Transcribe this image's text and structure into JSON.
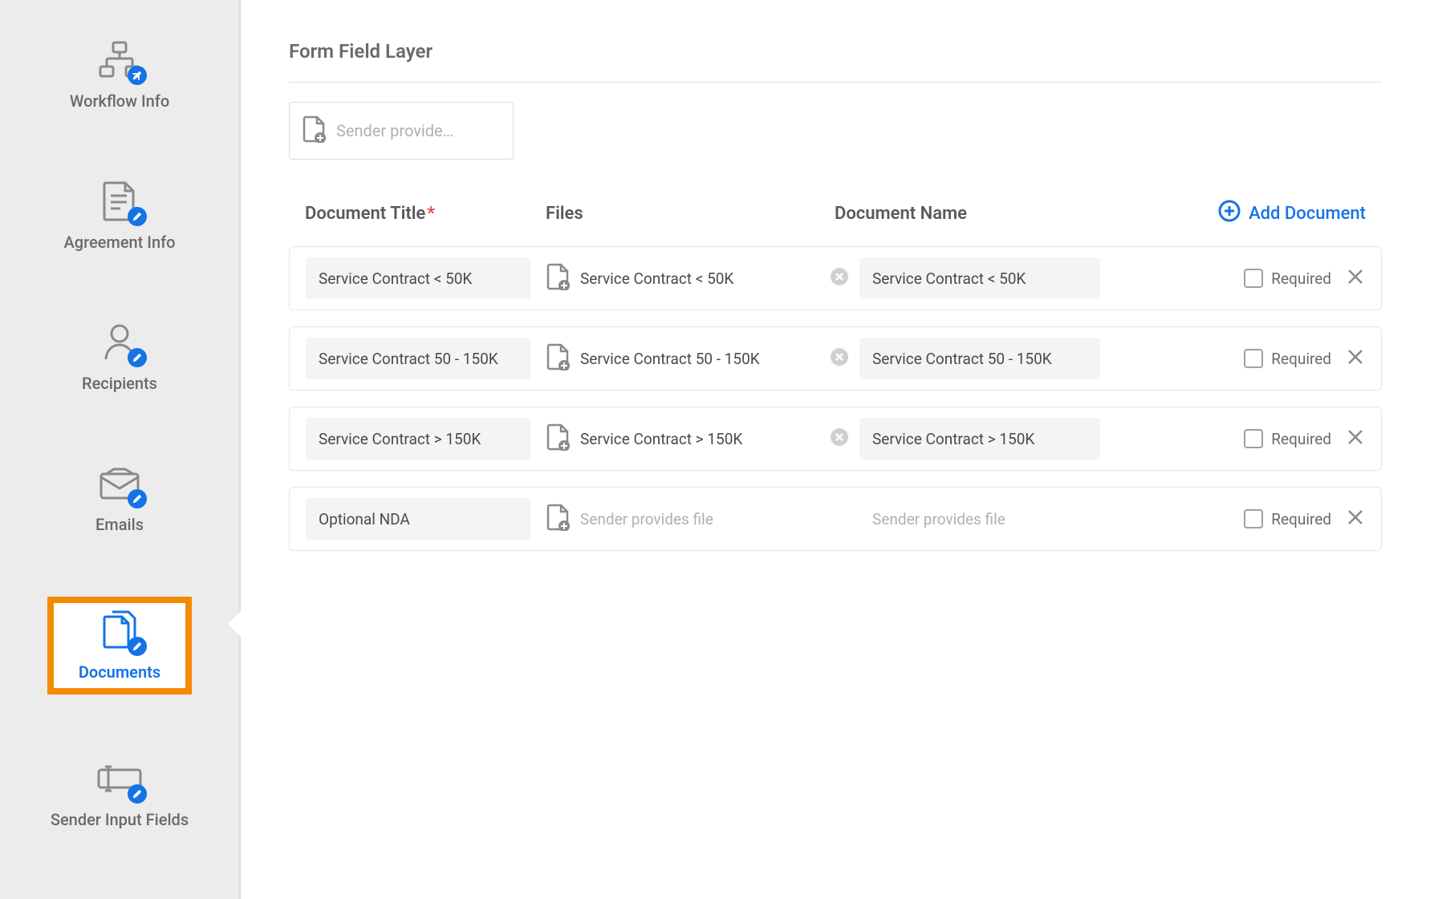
{
  "sidebar": {
    "items": [
      {
        "label": "Workflow Info"
      },
      {
        "label": "Agreement Info"
      },
      {
        "label": "Recipients"
      },
      {
        "label": "Emails"
      },
      {
        "label": "Documents"
      },
      {
        "label": "Sender Input Fields"
      }
    ]
  },
  "main": {
    "section_title": "Form Field Layer",
    "layer_placeholder": "Sender provide…",
    "table": {
      "headers": {
        "title": "Document Title",
        "files": "Files",
        "name": "Document Name"
      },
      "add_label": "Add Document",
      "required_label": "Required",
      "rows": [
        {
          "title": "Service Contract < 50K",
          "file": "Service Contract < 50K",
          "name": "Service Contract < 50K",
          "has_file": true
        },
        {
          "title": "Service Contract 50 - 150K",
          "file": "Service Contract 50 - 150K",
          "name": "Service Contract 50 - 150K",
          "has_file": true
        },
        {
          "title": "Service Contract > 150K",
          "file": "Service Contract > 150K",
          "name": "Service Contract > 150K",
          "has_file": true
        },
        {
          "title": "Optional NDA",
          "file": "Sender provides file",
          "name": "Sender provides file",
          "has_file": false
        }
      ]
    }
  }
}
